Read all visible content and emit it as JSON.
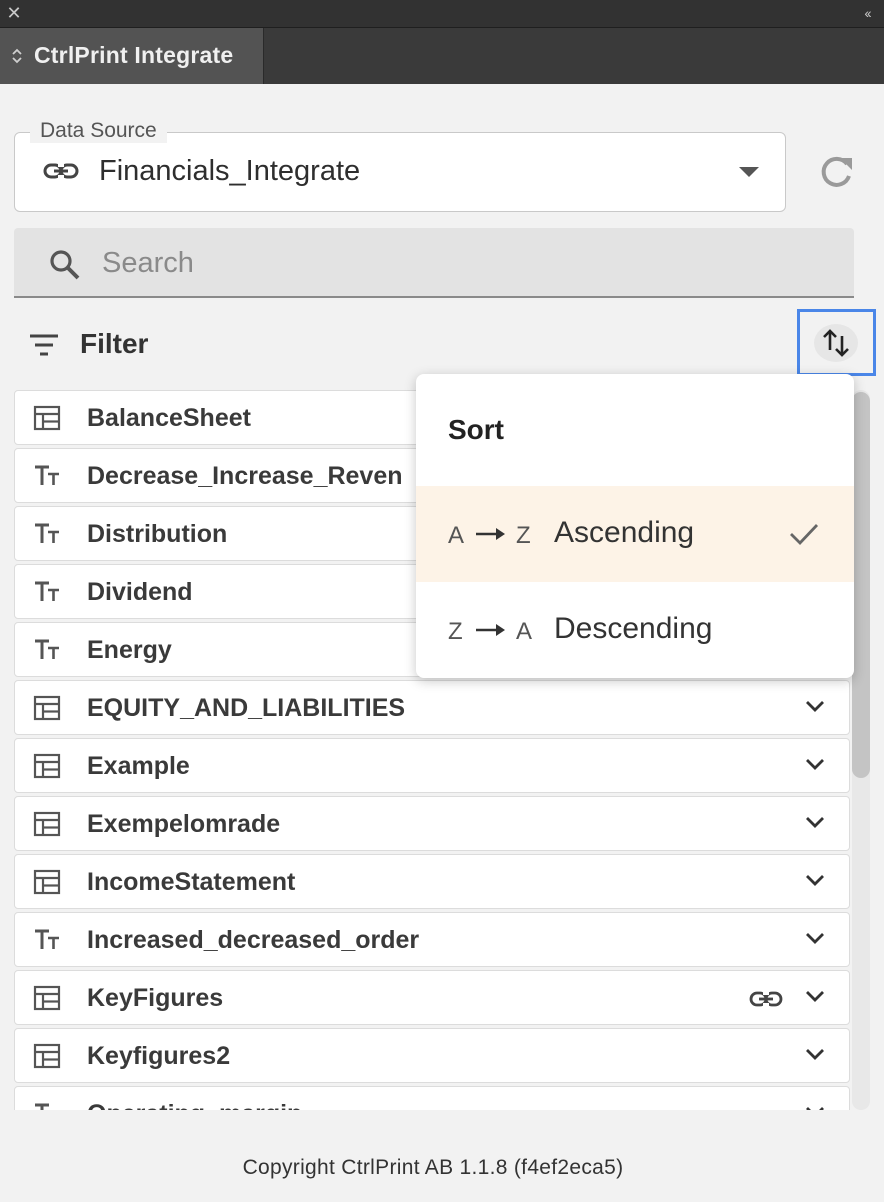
{
  "window": {
    "close_glyph": "✕",
    "collapse_glyph": "‹‹"
  },
  "tab": {
    "title": "CtrlPrint Integrate"
  },
  "data_source": {
    "legend": "Data Source",
    "value": "Financials_Integrate",
    "icon": "link-icon"
  },
  "search": {
    "placeholder": "Search"
  },
  "filter": {
    "label": "Filter"
  },
  "sort_menu": {
    "title": "Sort",
    "options": [
      {
        "from": "A",
        "to": "Z",
        "label": "Ascending",
        "selected": true
      },
      {
        "from": "Z",
        "to": "A",
        "label": "Descending",
        "selected": false
      }
    ]
  },
  "list": {
    "items": [
      {
        "name": "BalanceSheet",
        "type": "table-icon"
      },
      {
        "name": "Decrease_Increase_Reven",
        "type": "text-icon"
      },
      {
        "name": "Distribution",
        "type": "text-icon"
      },
      {
        "name": "Dividend",
        "type": "text-icon"
      },
      {
        "name": "Energy",
        "type": "text-icon"
      },
      {
        "name": "EQUITY_AND_LIABILITIES",
        "type": "table-icon"
      },
      {
        "name": "Example",
        "type": "table-icon"
      },
      {
        "name": "Exempelomrade",
        "type": "table-icon"
      },
      {
        "name": "IncomeStatement",
        "type": "table-icon"
      },
      {
        "name": "Increased_decreased_order",
        "type": "text-icon"
      },
      {
        "name": "KeyFigures",
        "type": "table-icon",
        "linked": true
      },
      {
        "name": "Keyfigures2",
        "type": "table-icon"
      },
      {
        "name": "Operating_margin",
        "type": "text-icon"
      }
    ]
  },
  "footer": {
    "copyright": "Copyright CtrlPrint AB 1.1.8 (f4ef2eca5)"
  },
  "colors": {
    "focus_ring": "#4a86e8",
    "selected_bg": "#fdf3e7"
  }
}
